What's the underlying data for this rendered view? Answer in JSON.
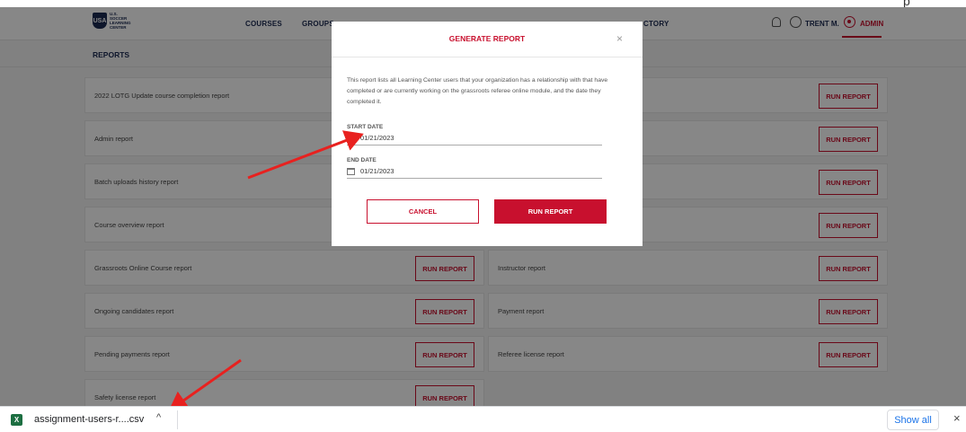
{
  "top_partial_text": "p",
  "header": {
    "logo_mark": "USA",
    "logo_text": "U.S. SOCCER LEARNING CENTER",
    "nav": [
      "COURSES",
      "GROUPS",
      "CTORY"
    ],
    "user_name": "TRENT M.",
    "admin_label": "ADMIN"
  },
  "subheader": {
    "title": "REPORTS"
  },
  "reports": {
    "run_label": "RUN REPORT",
    "left": [
      "2022 LOTG Update course completion report",
      "Admin report",
      "Batch uploads history report",
      "Course overview report",
      "Grassroots Online Course report",
      "Ongoing candidates report",
      "Pending payments report",
      "Safety license report"
    ],
    "right": [
      "",
      "",
      "",
      "",
      "Instructor report",
      "Payment report",
      "Referee license report"
    ]
  },
  "modal": {
    "title": "GENERATE REPORT",
    "close": "×",
    "description": "This report lists all Learning Center users that your organization has a relationship with that have completed or are currently working on the grassroots referee online module, and the date they completed it.",
    "start_label": "START DATE",
    "start_value": "01/21/2023",
    "end_label": "END DATE",
    "end_value": "01/21/2023",
    "cancel": "CANCEL",
    "run": "RUN REPORT"
  },
  "download_bar": {
    "file_name": "assignment-users-r....csv",
    "chevron": "^",
    "show_all": "Show all",
    "close": "×"
  },
  "colors": {
    "accent": "#c8102e",
    "navy": "#1b2a52",
    "arrow": "#e8211f"
  }
}
